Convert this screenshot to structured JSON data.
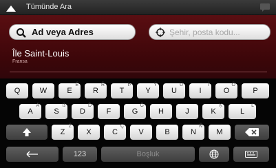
{
  "header": {
    "title": "Tümünde Ara"
  },
  "search": {
    "value": "Ad veya Adres",
    "city_placeholder": "Şehir, posta kodu..."
  },
  "result": {
    "name": "Île Saint-Louis",
    "country": "Fransa"
  },
  "keyboard": {
    "row1": [
      {
        "label": "Q",
        "sup": ""
      },
      {
        "label": "W",
        "sup": ""
      },
      {
        "label": "E",
        "sup": "É"
      },
      {
        "label": "R",
        "sup": "Ř"
      },
      {
        "label": "T",
        "sup": "Þ"
      },
      {
        "label": "Y",
        "sup": "Ý"
      },
      {
        "label": "U",
        "sup": "Ü"
      },
      {
        "label": "I",
        "sup": "Í"
      },
      {
        "label": "O",
        "sup": "Ö"
      },
      {
        "label": "P",
        "sup": ""
      }
    ],
    "row2": [
      {
        "label": "A",
        "sup": "Á"
      },
      {
        "label": "S",
        "sup": "ß"
      },
      {
        "label": "D",
        "sup": "Ď"
      },
      {
        "label": "F",
        "sup": ""
      },
      {
        "label": "G",
        "sup": "Ğ"
      },
      {
        "label": "H",
        "sup": ""
      },
      {
        "label": "J",
        "sup": ""
      },
      {
        "label": "K",
        "sup": "Ķ"
      },
      {
        "label": "L",
        "sup": "Ľ"
      }
    ],
    "row3": [
      {
        "label": "Z",
        "sup": "Ž"
      },
      {
        "label": "X",
        "sup": ""
      },
      {
        "label": "C",
        "sup": "Ç"
      },
      {
        "label": "V",
        "sup": ""
      },
      {
        "label": "B",
        "sup": ""
      },
      {
        "label": "N",
        "sup": "Ñ"
      },
      {
        "label": "M",
        "sup": ""
      }
    ],
    "numbers_label": "123",
    "space_label": "Boşluk"
  },
  "icons": [
    "back-arrow-icon",
    "message-icon",
    "search-icon",
    "target-icon",
    "shift-icon",
    "backspace-icon",
    "left-arrow-icon",
    "globe-icon",
    "keyboard-icon"
  ]
}
